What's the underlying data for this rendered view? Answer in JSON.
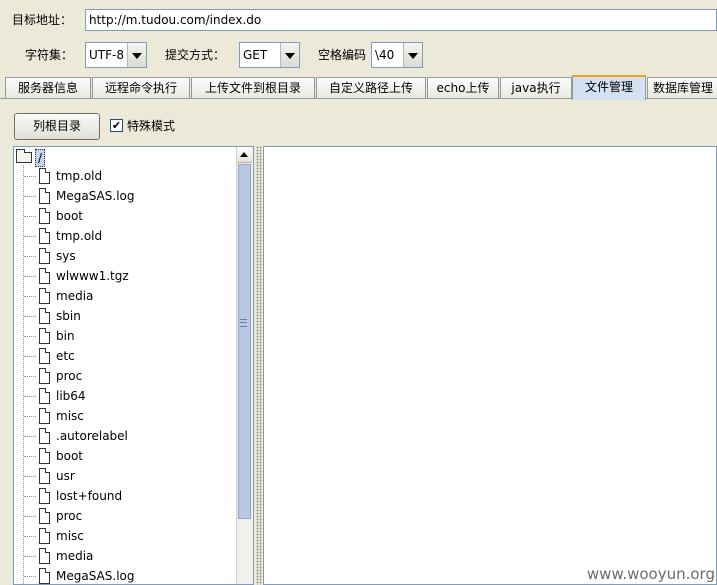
{
  "target": {
    "label": "目标地址：",
    "url": "http://m.tudou.com/index.do"
  },
  "charset": {
    "label": "字符集：",
    "value": "UTF-8"
  },
  "method": {
    "label": "提交方式：",
    "value": "GET"
  },
  "space": {
    "label": "空格编码",
    "value": "\\40"
  },
  "tabs": [
    {
      "label": "服务器信息"
    },
    {
      "label": "远程命令执行"
    },
    {
      "label": "上传文件到根目录"
    },
    {
      "label": "自定义路径上传"
    },
    {
      "label": "echo上传"
    },
    {
      "label": "java执行"
    },
    {
      "label": "文件管理"
    },
    {
      "label": "数据库管理"
    }
  ],
  "active_tab": "文件管理",
  "list_root_button": "列根目录",
  "special_mode": {
    "label": "特殊模式",
    "checked": true,
    "mark": "✔"
  },
  "tree": {
    "root": "/",
    "items": [
      "tmp.old",
      "MegaSAS.log",
      "boot",
      "tmp.old",
      "sys",
      "wlwww1.tgz",
      "media",
      "sbin",
      "bin",
      "etc",
      "proc",
      "lib64",
      "misc",
      ".autorelabel",
      "boot",
      "usr",
      "lost+found",
      "proc",
      "misc",
      "media",
      "MegaSAS.log"
    ]
  },
  "watermark": "www.wooyun.org",
  "colors": {
    "window_bg": "#ece9d8",
    "active_tab_bg": "#d4e1f2",
    "active_tab_accent": "#f0a020",
    "field_border": "#7f9db9"
  }
}
